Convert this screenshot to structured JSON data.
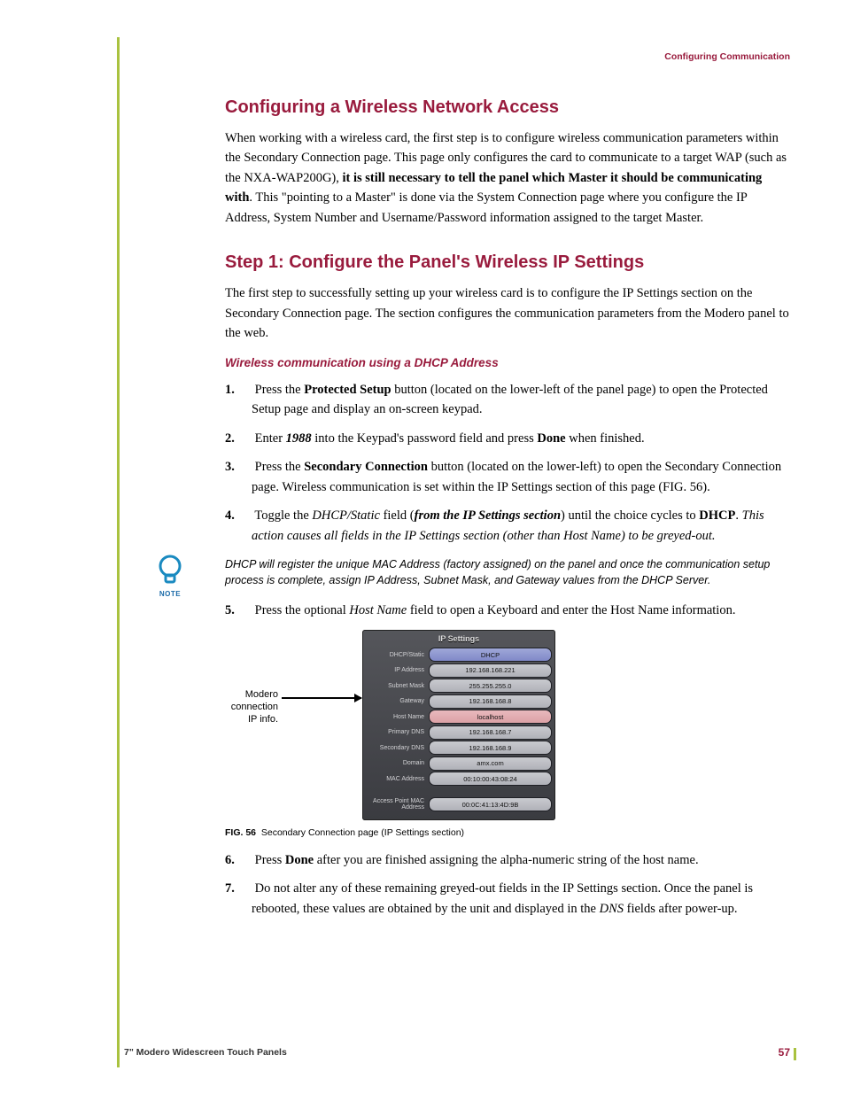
{
  "header": "Configuring Communication",
  "h1": "Configuring a Wireless Network Access",
  "intro": {
    "a": "When working with a wireless card, the first step is to configure wireless communication parameters within the Secondary Connection page. This page only configures the card to communicate to a target WAP (such as the NXA-WAP200G),",
    "b": "it is still necessary to tell the panel which Master it should be communicating with",
    "c": ". This \"pointing to a Master\" is done via the System Connection page where you configure the IP Address, System Number and Username/Password information assigned to the target Master."
  },
  "h2": "Step 1: Configure the Panel's Wireless IP Settings",
  "p2": "The first step to successfully setting up your wireless card is to configure the IP Settings section on the Secondary Connection page. The section configures the communication parameters from the Modero panel to the web.",
  "h3": "Wireless communication using a DHCP Address",
  "steps": [
    {
      "a": "Press the",
      "b": "Protected Setup",
      "c": "button (located on the lower-left of the panel page) to open the Protected Setup page and display an on-screen keypad."
    },
    {
      "a": "Enter",
      "b": "1988",
      "c": "into the Keypad's password field and press",
      "d": "Done",
      "e": "when finished."
    },
    {
      "a": "Press the",
      "b": "Secondary Connection",
      "c": "button (located on the lower-left) to open the Secondary Connection page. Wireless communication is set within the IP Settings section of this page (FIG. 56)."
    },
    {
      "a": "Toggle the",
      "b": "DHCP/Static",
      "c": "field",
      "d": "from the IP Settings section",
      "e": "until the choice cycles to",
      "f": "DHCP",
      "g": "This action causes all fields in the IP Settings section (other than Host Name) to be greyed-out."
    },
    {
      "a": "Press the optional",
      "b": "Host Name",
      "c": "field to open a Keyboard and enter the Host Name information."
    },
    {
      "a": "Press",
      "b": "Done",
      "c": "after you are finished assigning the alpha-numeric string of the host name."
    },
    {
      "a": "Do not alter any of these remaining greyed-out fields in the IP Settings section. Once the panel is rebooted, these values are obtained by the unit and displayed in the",
      "b": "DNS",
      "c": "fields after power-up."
    }
  ],
  "note": {
    "label": "NOTE",
    "text": "DHCP will register the unique MAC Address (factory assigned) on the panel and once the communication setup process is complete, assign IP Address, Subnet Mask, and Gateway values from the DHCP Server."
  },
  "fig": {
    "callout": [
      "Modero",
      "connection",
      "IP info."
    ],
    "title": "IP Settings",
    "rows": [
      {
        "k": "DHCP/Static",
        "v": "DHCP"
      },
      {
        "k": "IP Address",
        "v": "192.168.168.221"
      },
      {
        "k": "Subnet Mask",
        "v": "255.255.255.0"
      },
      {
        "k": "Gateway",
        "v": "192.168.168.8"
      },
      {
        "k": "Host Name",
        "v": "localhost"
      },
      {
        "k": "Primary DNS",
        "v": "192.168.168.7"
      },
      {
        "k": "Secondary DNS",
        "v": "192.168.168.9"
      },
      {
        "k": "Domain",
        "v": "amx.com"
      },
      {
        "k": "MAC Address",
        "v": "00:10:00:43:08:24"
      },
      {
        "k": "Access Point MAC Address",
        "v": "00:0C:41:13:4D:9B"
      }
    ],
    "caption": {
      "num": "FIG. 56",
      "text": "Secondary Connection page (IP Settings section)"
    }
  },
  "footer": {
    "title": "7\" Modero Widescreen Touch Panels",
    "page": "57"
  }
}
